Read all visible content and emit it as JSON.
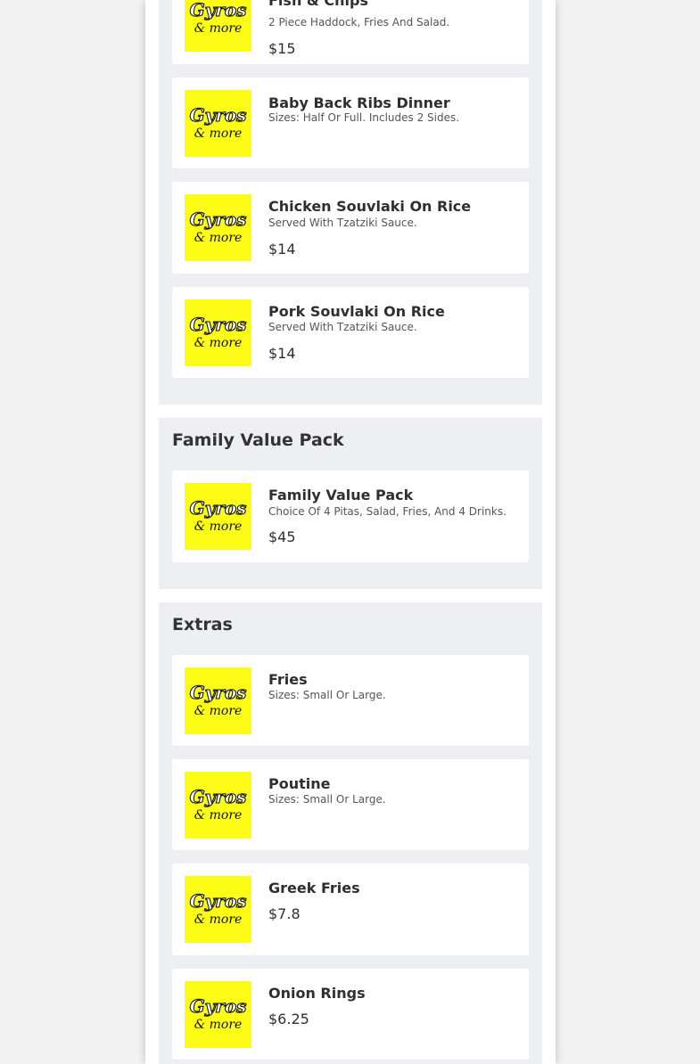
{
  "logo": {
    "line1": "Gyros",
    "line2": "& more",
    "icon": "gyros-and-more-logo",
    "color": "#fdfc17"
  },
  "sections": [
    {
      "title": "",
      "items": [
        {
          "name": "Fish & Chips",
          "description": "2 Piece Haddock, Fries And Salad.",
          "price": "$15"
        },
        {
          "name": "Baby Back Ribs Dinner",
          "description": "Sizes: Half Or Full. Includes 2 Sides.",
          "price": ""
        },
        {
          "name": "Chicken Souvlaki On Rice",
          "description": "Served With Tzatziki Sauce.",
          "price": "$14"
        },
        {
          "name": "Pork Souvlaki On Rice",
          "description": "Served With Tzatziki Sauce.",
          "price": "$14"
        }
      ]
    },
    {
      "title": "Family Value Pack",
      "items": [
        {
          "name": "Family Value Pack",
          "description": "Choice Of 4 Pitas, Salad, Fries, And 4 Drinks.",
          "price": "$45"
        }
      ]
    },
    {
      "title": "Extras",
      "items": [
        {
          "name": "Fries",
          "description": "Sizes: Small Or Large.",
          "price": ""
        },
        {
          "name": "Poutine",
          "description": "Sizes: Small Or Large.",
          "price": ""
        },
        {
          "name": "Greek Fries",
          "description": "",
          "price": "$7.8"
        },
        {
          "name": "Onion Rings",
          "description": "",
          "price": "$6.25"
        }
      ]
    }
  ]
}
